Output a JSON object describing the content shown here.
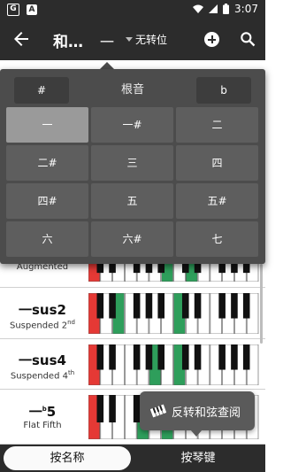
{
  "status_bar": {
    "time": "3:07",
    "left_icons": [
      "G",
      "A"
    ]
  },
  "toolbar": {
    "title": "和…",
    "root_value": "一",
    "inversion_value": "无转位",
    "back_icon": "back-arrow-icon",
    "add_icon": "add-circle-icon",
    "search_icon": "search-icon"
  },
  "root_panel": {
    "label": "根音",
    "sharp_label": "#",
    "flat_label": "b",
    "selected": "一",
    "degrees": [
      "一",
      "一#",
      "二",
      "二#",
      "三",
      "四",
      "四#",
      "五",
      "五#",
      "六",
      "六#",
      "七"
    ]
  },
  "chords": [
    {
      "symbol": "",
      "name": "Augmented",
      "name_sup": "",
      "red": [
        0
      ],
      "green": [
        6,
        8
      ]
    },
    {
      "symbol": "一sus2",
      "name": "Suspended 2",
      "name_sup": "nd",
      "red": [
        0
      ],
      "green": [
        2,
        7
      ]
    },
    {
      "symbol": "一sus4",
      "name": "Suspended 4",
      "name_sup": "th",
      "red": [
        0
      ],
      "green": [
        5,
        7
      ]
    },
    {
      "symbol": "一",
      "symbol_sup": "b",
      "symbol_suffix": "5",
      "name": "Flat Fifth",
      "name_sup": "",
      "red": [
        0
      ],
      "green": [
        4,
        6
      ]
    }
  ],
  "float_button": {
    "label": "反转和弦查阅",
    "icon": "piano-keys-icon"
  },
  "tabs": [
    {
      "label": "按名称",
      "active": true
    },
    {
      "label": "按琴键",
      "active": false
    }
  ],
  "colors": {
    "dark": "#2c2c2c",
    "panel": "#4c4c4c",
    "root_key": "#e53935",
    "chord_key": "#2e9e5b"
  }
}
